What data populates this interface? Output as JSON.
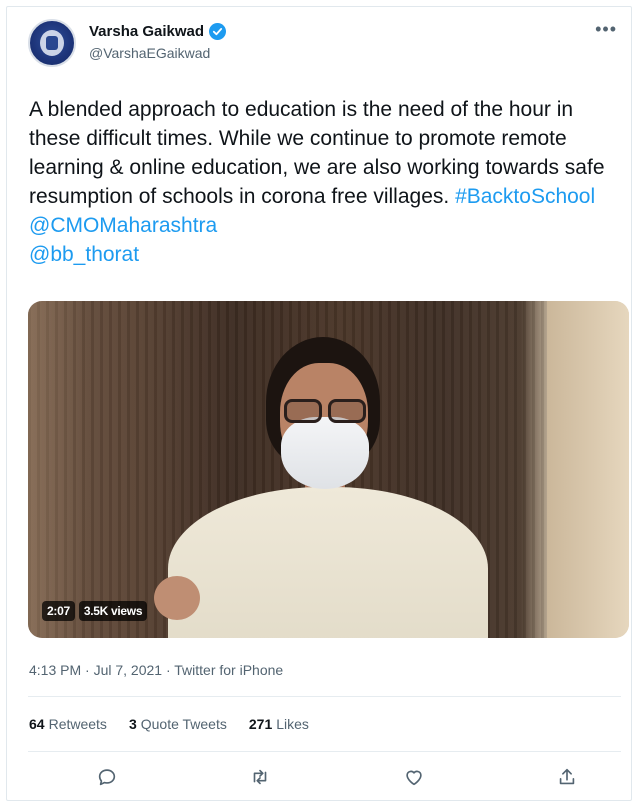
{
  "author": {
    "display_name": "Varsha Gaikwad",
    "handle": "@VarshaEGaikwad",
    "verified": true
  },
  "tweet": {
    "text_main": "A blended approach to education is the need of the hour in these difficult times. While we continue to promote remote learning & online education, we are also working towards safe resumption of schools in corona free villages. ",
    "hashtag": "#BacktoSchool",
    "mention_1": "@CMOMaharashtra",
    "mention_2": "@bb_thorat"
  },
  "video": {
    "duration": "2:07",
    "views": "3.5K views"
  },
  "meta": {
    "timestamp": "4:13 PM · Jul 7, 2021 · Twitter for iPhone"
  },
  "stats": {
    "retweets_count": "64",
    "retweets_label": "Retweets",
    "quote_count": "3",
    "quote_label": "Quote Tweets",
    "likes_count": "271",
    "likes_label": "Likes"
  },
  "actions": {
    "icons": [
      "reply-icon",
      "retweet-icon",
      "like-icon",
      "share-icon"
    ]
  },
  "colors": {
    "accent": "#1d9bf0",
    "secondary_text": "#536471"
  }
}
